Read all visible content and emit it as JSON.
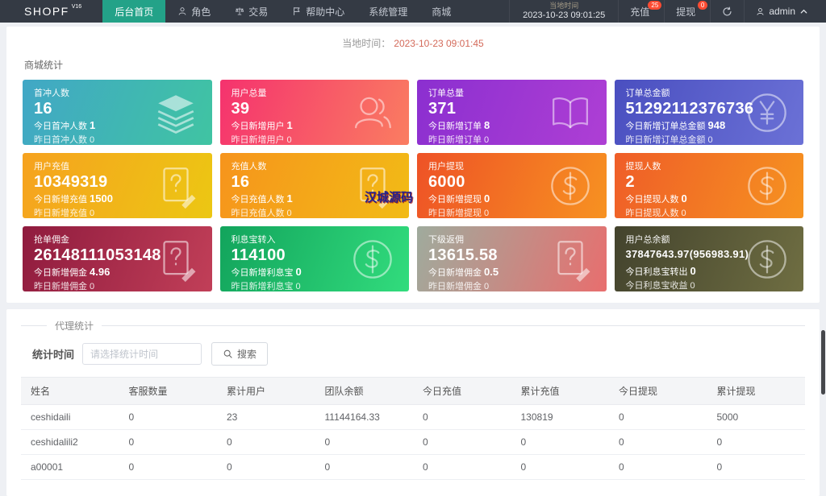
{
  "navbar": {
    "logo": "SHOPF",
    "logo_version": "V16",
    "menu": [
      {
        "label": "后台首页",
        "icon": null,
        "active": true
      },
      {
        "label": "角色",
        "icon": "person",
        "active": false
      },
      {
        "label": "交易",
        "icon": "scales",
        "active": false
      },
      {
        "label": "帮助中心",
        "icon": "flag",
        "active": false
      },
      {
        "label": "系统管理",
        "icon": null,
        "active": false
      },
      {
        "label": "商城",
        "icon": null,
        "active": false
      }
    ],
    "local_time": {
      "label": "当地时间",
      "value": "2023-10-23 09:01:25"
    },
    "quick": [
      {
        "name": "recharge",
        "label": "充值",
        "badge": "25"
      },
      {
        "name": "withdraw",
        "label": "提现",
        "badge": "0"
      }
    ],
    "user": {
      "name": "admin"
    }
  },
  "stats": {
    "local_time_label": "当地时间：",
    "local_time_value": "2023-10-23 09:01:45",
    "section_title": "商城统计",
    "cards": [
      {
        "title": "首冲人数",
        "value": "16",
        "today_label": "今日首冲人数",
        "today_value": "1",
        "yesterday_label": "昨日首冲人数",
        "yesterday_value": "0",
        "icon": "layers",
        "colors": [
          "#41a7c6",
          "#40c4a2"
        ]
      },
      {
        "title": "用户总量",
        "value": "39",
        "today_label": "今日新增用户",
        "today_value": "1",
        "yesterday_label": "昨日新增用户",
        "yesterday_value": "0",
        "icon": "users",
        "colors": [
          "#f5326e",
          "#fa7d61"
        ]
      },
      {
        "title": "订单总量",
        "value": "371",
        "today_label": "今日新增订单",
        "today_value": "8",
        "yesterday_label": "昨日新增订单",
        "yesterday_value": "0",
        "icon": "book",
        "colors": [
          "#8b2fd0",
          "#ae3fd4"
        ]
      },
      {
        "title": "订单总金额",
        "value": "51292112376736",
        "today_label": "今日新增订单总金额",
        "today_value": "948",
        "yesterday_label": "昨日新增订单总金额",
        "yesterday_value": "0",
        "icon": "yen",
        "colors": [
          "#4a4fc0",
          "#6b71d6"
        ]
      },
      {
        "title": "用户充值",
        "value": "10349319",
        "today_label": "今日新增充值",
        "today_value": "1500",
        "yesterday_label": "昨日新增充值",
        "yesterday_value": "0",
        "icon": "doc",
        "colors": [
          "#f6a21f",
          "#ecc713"
        ]
      },
      {
        "title": "充值人数",
        "value": "16",
        "today_label": "今日充值人数",
        "today_value": "1",
        "yesterday_label": "昨日充值人数",
        "yesterday_value": "0",
        "icon": "doc",
        "colors": [
          "#f6941c",
          "#f2bb16"
        ]
      },
      {
        "title": "用户提现",
        "value": "6000",
        "today_label": "今日新增提现",
        "today_value": "0",
        "yesterday_label": "昨日新增提现",
        "yesterday_value": "0",
        "icon": "dollar",
        "colors": [
          "#ee5226",
          "#f79221"
        ]
      },
      {
        "title": "提现人数",
        "value": "2",
        "today_label": "今日提现人数",
        "today_value": "0",
        "yesterday_label": "昨日提现人数",
        "yesterday_value": "0",
        "icon": "dollar",
        "colors": [
          "#ef5d28",
          "#f69320"
        ]
      },
      {
        "title": "抢单佣金",
        "value": "26148111053148",
        "today_label": "今日新增佣金",
        "today_value": "4.96",
        "yesterday_label": "昨日新增佣金",
        "yesterday_value": "0",
        "icon": "doc",
        "colors": [
          "#8f1b3e",
          "#c13f58"
        ]
      },
      {
        "title": "利息宝转入",
        "value": "114100",
        "today_label": "今日新增利息宝",
        "today_value": "0",
        "yesterday_label": "昨日新增利息宝",
        "yesterday_value": "0",
        "icon": "dollar",
        "colors": [
          "#12a45c",
          "#32dc7d"
        ]
      },
      {
        "title": "下级返佣",
        "value": "13615.58",
        "today_label": "今日新增佣金",
        "today_value": "0.5",
        "yesterday_label": "昨日新增佣金",
        "yesterday_value": "0",
        "icon": "doc",
        "colors": [
          "#9fab9d",
          "#e86e6e"
        ]
      },
      {
        "title": "用户总余额",
        "value": "37847643.97(956983.91)",
        "small_value": true,
        "today_label": "今日利息宝转出",
        "today_value": "0",
        "yesterday_label": "今日利息宝收益",
        "yesterday_value": "0",
        "icon": "dollar",
        "colors": [
          "#43432d",
          "#6f6e42"
        ]
      }
    ]
  },
  "agent": {
    "legend": "代理统计",
    "filter_label": "统计时间",
    "filter_placeholder": "请选择统计时间",
    "search_label": "搜索",
    "table": {
      "headers": [
        "姓名",
        "客服数量",
        "累计用户",
        "团队余额",
        "今日充值",
        "累计充值",
        "今日提现",
        "累计提现"
      ],
      "rows": [
        [
          "ceshidaili",
          "0",
          "23",
          "11144164.33",
          "0",
          "130819",
          "0",
          "5000"
        ],
        [
          "ceshidalili2",
          "0",
          "0",
          "0",
          "0",
          "0",
          "0",
          "0"
        ],
        [
          "a00001",
          "0",
          "0",
          "0",
          "0",
          "0",
          "0",
          "0"
        ]
      ]
    }
  },
  "watermark": "汉城源码"
}
